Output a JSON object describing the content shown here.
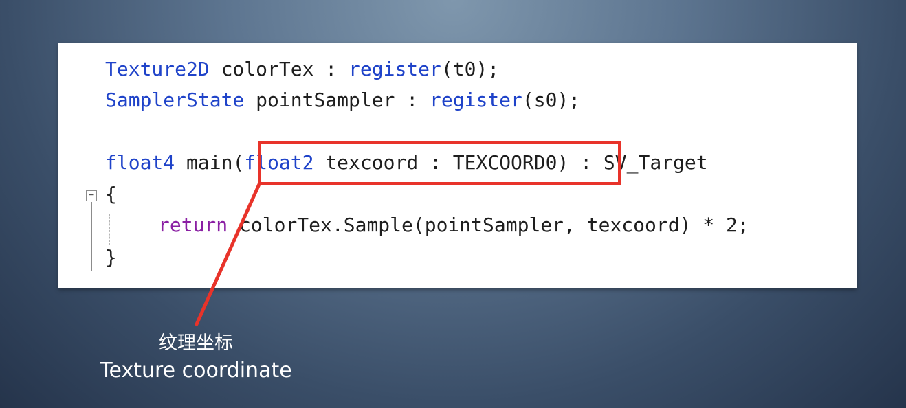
{
  "code": {
    "line1": {
      "type": "Texture2D",
      "rest1": " colorTex : ",
      "func": "register",
      "rest2": "(t0);"
    },
    "line2": {
      "type": "SamplerState",
      "rest1": " pointSampler : ",
      "func": "register",
      "rest2": "(s0);"
    },
    "line3": {
      "ret_type": "float4",
      "name": " main(",
      "param_type": "float2",
      "param_rest": " texcoord : TEXCOORD0",
      "tail": ") : SV_Target"
    },
    "open_brace": "{",
    "line4": {
      "keyword": "return",
      "rest": " colorTex.Sample(pointSampler, texcoord) * 2;"
    },
    "close_brace": "}",
    "fold_marker": "−"
  },
  "annotation": {
    "label_cn": "纹理坐标",
    "label_en": "Texture coordinate"
  },
  "colors": {
    "keyword_type": "#1f43c9",
    "keyword_control": "#8a1fa3",
    "highlight": "#e8332a",
    "caption_text": "#ffffff"
  }
}
